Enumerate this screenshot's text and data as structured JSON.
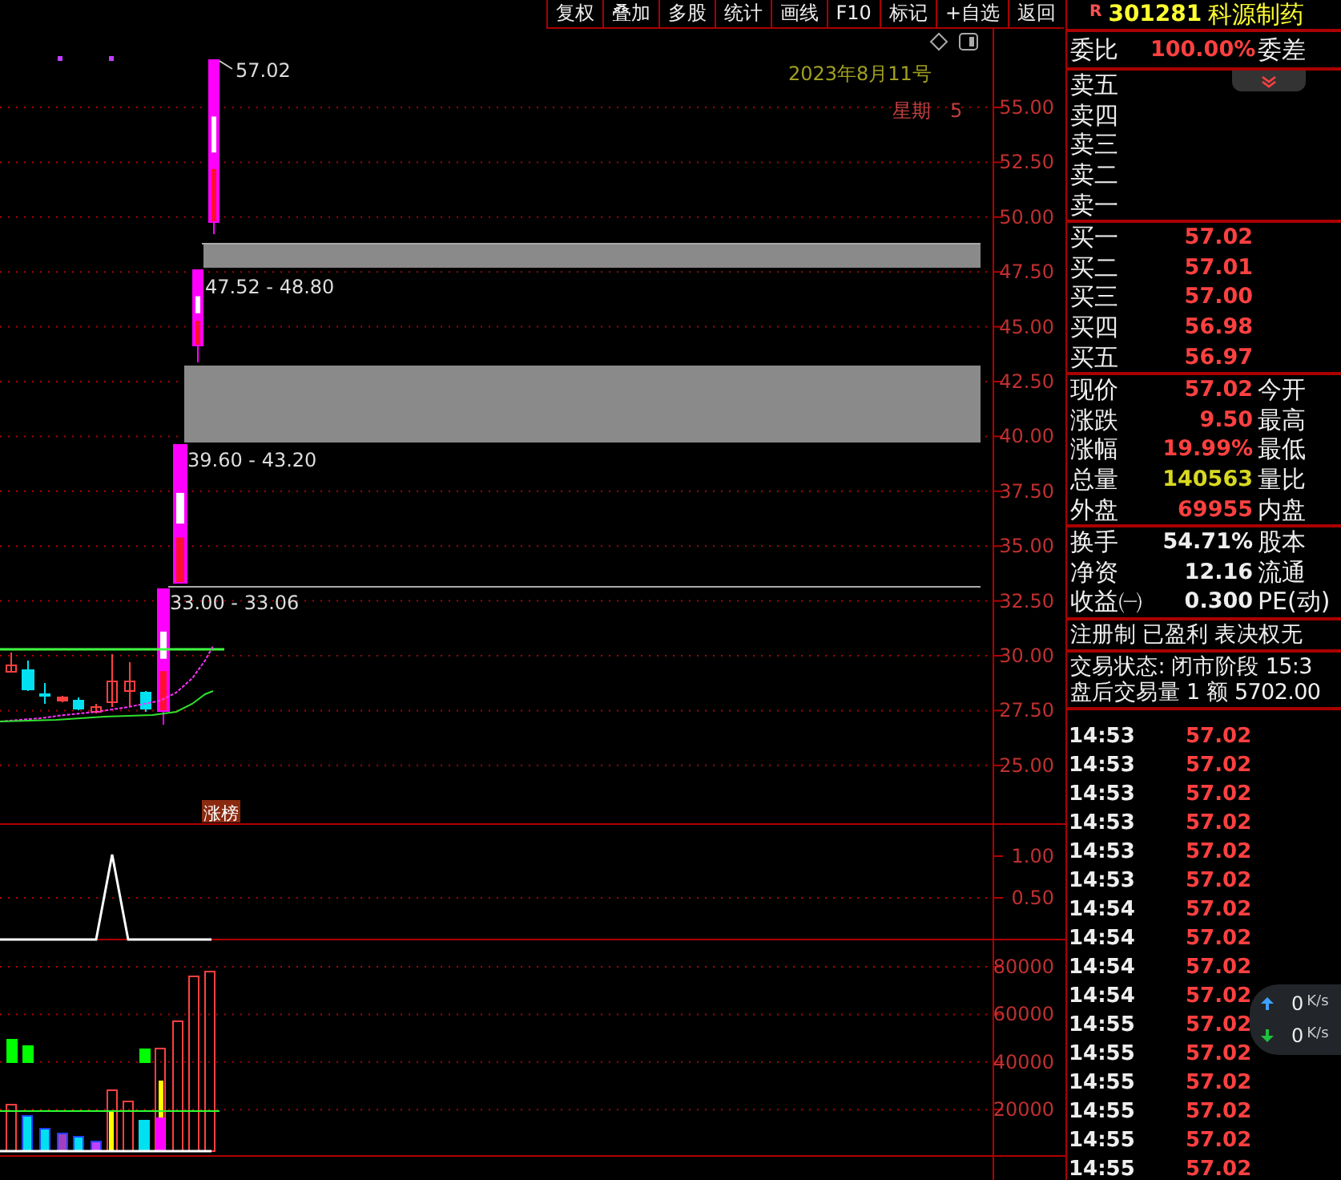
{
  "toolbar": [
    {
      "label": "复权"
    },
    {
      "label": "叠加"
    },
    {
      "label": "多股"
    },
    {
      "label": "统计"
    },
    {
      "label": "画线"
    },
    {
      "label": "F10"
    },
    {
      "label": "标记"
    },
    {
      "label": "+自选"
    },
    {
      "label": "返回"
    }
  ],
  "quote_header": {
    "badge": "R",
    "code": "301281",
    "name": "科源制药"
  },
  "order_ratio": {
    "label": "委比",
    "value": "100.00%",
    "label_2": "委差"
  },
  "asks": [
    {
      "label": "卖五"
    },
    {
      "label": "卖四"
    },
    {
      "label": "卖三"
    },
    {
      "label": "卖二"
    },
    {
      "label": "卖一"
    }
  ],
  "bids": [
    {
      "label": "买一",
      "price": "57.02"
    },
    {
      "label": "买二",
      "price": "57.01"
    },
    {
      "label": "买三",
      "price": "57.00"
    },
    {
      "label": "买四",
      "price": "56.98"
    },
    {
      "label": "买五",
      "price": "56.97"
    }
  ],
  "stats": [
    {
      "label": "现价",
      "value": "57.02",
      "label_2": "今开",
      "color": "#ff4040"
    },
    {
      "label": "涨跌",
      "value": "9.50",
      "label_2": "最高",
      "color": "#ff4040"
    },
    {
      "label": "涨幅",
      "value": "19.99%",
      "label_2": "最低",
      "color": "#ff4040"
    },
    {
      "label": "总量",
      "value": "140563",
      "label_2": "量比",
      "color": "#d8d820"
    },
    {
      "label": "外盘",
      "value": "69955",
      "label_2": "内盘",
      "color": "#ff4040"
    }
  ],
  "fundamentals": [
    {
      "label": "换手",
      "value": "54.71%",
      "label_2": "股本"
    },
    {
      "label": "净资",
      "value": "12.16",
      "label_2": "流通"
    },
    {
      "label": "收益㈠",
      "value": "0.300",
      "label_2": "PE(动)"
    }
  ],
  "notes": [
    "注册制 已盈利 表决权无",
    "交易状态: 闭市阶段 15:3",
    "盘后交易量 1 额 5702.00"
  ],
  "ticks": [
    {
      "time": "14:53",
      "price": "57.02"
    },
    {
      "time": "14:53",
      "price": "57.02"
    },
    {
      "time": "14:53",
      "price": "57.02"
    },
    {
      "time": "14:53",
      "price": "57.02"
    },
    {
      "time": "14:53",
      "price": "57.02"
    },
    {
      "time": "14:53",
      "price": "57.02"
    },
    {
      "time": "14:54",
      "price": "57.02"
    },
    {
      "time": "14:54",
      "price": "57.02"
    },
    {
      "time": "14:54",
      "price": "57.02"
    },
    {
      "time": "14:54",
      "price": "57.02"
    },
    {
      "time": "14:55",
      "price": "57.02"
    },
    {
      "time": "14:55",
      "price": "57.02"
    },
    {
      "time": "14:55",
      "price": "57.02"
    },
    {
      "time": "14:55",
      "price": "57.02"
    },
    {
      "time": "14:55",
      "price": "57.02"
    },
    {
      "time": "14:55",
      "price": "57.02"
    }
  ],
  "chart": {
    "date": "2023年8月11号",
    "weekday_label": "星期",
    "weekday": "5",
    "high_label": "57.02",
    "ranges": [
      "47.52 - 48.80",
      "39.60 - 43.20",
      "33.00 - 33.06"
    ],
    "tag": "涨榜",
    "price_axis": [
      "55.00",
      "52.50",
      "50.00",
      "47.50",
      "45.00",
      "42.50",
      "40.00",
      "37.50",
      "35.00",
      "32.50",
      "30.00",
      "27.50",
      "25.00"
    ]
  },
  "indicator_axis": [
    "1.00",
    "0.50"
  ],
  "volume_axis": [
    "80000",
    "60000",
    "40000",
    "20000"
  ],
  "speed_widget": {
    "upload": "0",
    "upload_unit": "K/s",
    "download": "0",
    "download_unit": "K/s"
  }
}
